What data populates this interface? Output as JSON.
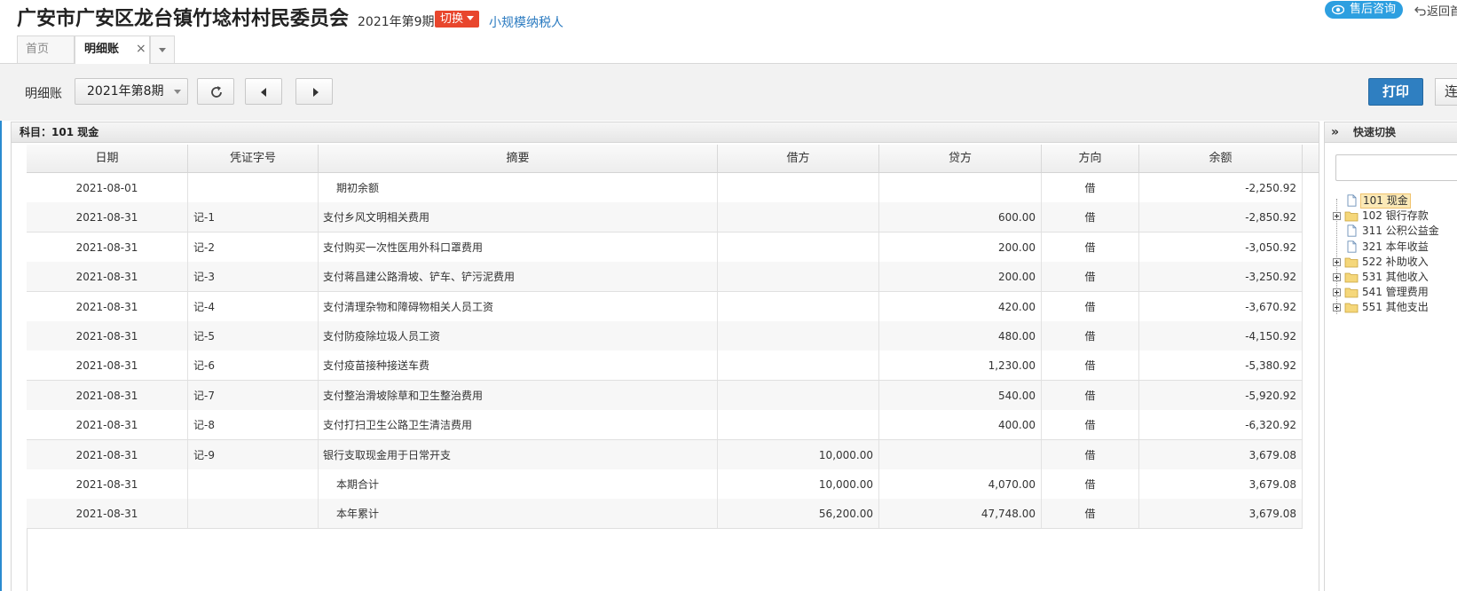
{
  "header": {
    "org_name": "广安市广安区龙台镇竹埝村村民委员会",
    "period": "2021年第9期",
    "switch_label": "切换",
    "taxpayer_type": "小规模纳税人",
    "service_label": "售后咨询",
    "back_label": "返回首"
  },
  "tabs": {
    "home": "首页",
    "ledger": "明细账",
    "close_glyph": "×"
  },
  "toolbar": {
    "label": "明细账",
    "period_value": "2021年第8期",
    "print_label": "打印",
    "continuous_label": "连"
  },
  "ledger": {
    "subject_label": "科目：101  现金",
    "columns": [
      "日期",
      "凭证字号",
      "摘要",
      "借方",
      "贷方",
      "方向",
      "余额"
    ],
    "rows": [
      {
        "date": "2021-08-01",
        "voucher": "",
        "summary": "期初余额",
        "debit": "",
        "credit": "",
        "direction": "借",
        "balance": "-2,250.92"
      },
      {
        "date": "2021-08-31",
        "voucher": "记-1",
        "summary": "支付乡风文明相关费用",
        "debit": "",
        "credit": "600.00",
        "direction": "借",
        "balance": "-2,850.92"
      },
      {
        "date": "2021-08-31",
        "voucher": "记-2",
        "summary": "支付购买一次性医用外科口罩费用",
        "debit": "",
        "credit": "200.00",
        "direction": "借",
        "balance": "-3,050.92"
      },
      {
        "date": "2021-08-31",
        "voucher": "记-3",
        "summary": "支付蒋昌建公路滑坡、铲车、铲污泥费用",
        "debit": "",
        "credit": "200.00",
        "direction": "借",
        "balance": "-3,250.92"
      },
      {
        "date": "2021-08-31",
        "voucher": "记-4",
        "summary": "支付清理杂物和障碍物相关人员工资",
        "debit": "",
        "credit": "420.00",
        "direction": "借",
        "balance": "-3,670.92"
      },
      {
        "date": "2021-08-31",
        "voucher": "记-5",
        "summary": "支付防疫除垃圾人员工资",
        "debit": "",
        "credit": "480.00",
        "direction": "借",
        "balance": "-4,150.92"
      },
      {
        "date": "2021-08-31",
        "voucher": "记-6",
        "summary": "支付疫苗接种接送车费",
        "debit": "",
        "credit": "1,230.00",
        "direction": "借",
        "balance": "-5,380.92"
      },
      {
        "date": "2021-08-31",
        "voucher": "记-7",
        "summary": "支付整治滑坡除草和卫生整治费用",
        "debit": "",
        "credit": "540.00",
        "direction": "借",
        "balance": "-5,920.92"
      },
      {
        "date": "2021-08-31",
        "voucher": "记-8",
        "summary": "支付打扫卫生公路卫生清洁费用",
        "debit": "",
        "credit": "400.00",
        "direction": "借",
        "balance": "-6,320.92"
      },
      {
        "date": "2021-08-31",
        "voucher": "记-9",
        "summary": "银行支取现金用于日常开支",
        "debit": "10,000.00",
        "credit": "",
        "direction": "借",
        "balance": "3,679.08"
      },
      {
        "date": "2021-08-31",
        "voucher": "",
        "summary": "本期合计",
        "debit": "10,000.00",
        "credit": "4,070.00",
        "direction": "借",
        "balance": "3,679.08"
      },
      {
        "date": "2021-08-31",
        "voucher": "",
        "summary": "本年累计",
        "debit": "56,200.00",
        "credit": "47,748.00",
        "direction": "借",
        "balance": "3,679.08"
      }
    ]
  },
  "quick_switch": {
    "title": "快速切换",
    "chevron": "»",
    "search_value": "",
    "items": [
      {
        "label": "101 现金",
        "type": "leaf",
        "selected": true
      },
      {
        "label": "102 银行存款",
        "type": "folder",
        "selected": false
      },
      {
        "label": "311 公积公益金",
        "type": "leaf",
        "selected": false
      },
      {
        "label": "321 本年收益",
        "type": "leaf",
        "selected": false
      },
      {
        "label": "522 补助收入",
        "type": "folder",
        "selected": false
      },
      {
        "label": "531 其他收入",
        "type": "folder",
        "selected": false
      },
      {
        "label": "541 管理费用",
        "type": "folder",
        "selected": false
      },
      {
        "label": "551 其他支出",
        "type": "folder",
        "selected": false
      }
    ]
  },
  "colors": {
    "accent": "#2f7fc1",
    "switch_bg": "#e8462d",
    "service_bg": "#2d9fe0",
    "link": "#2a7ac0",
    "selection": "#fbe9b7"
  }
}
